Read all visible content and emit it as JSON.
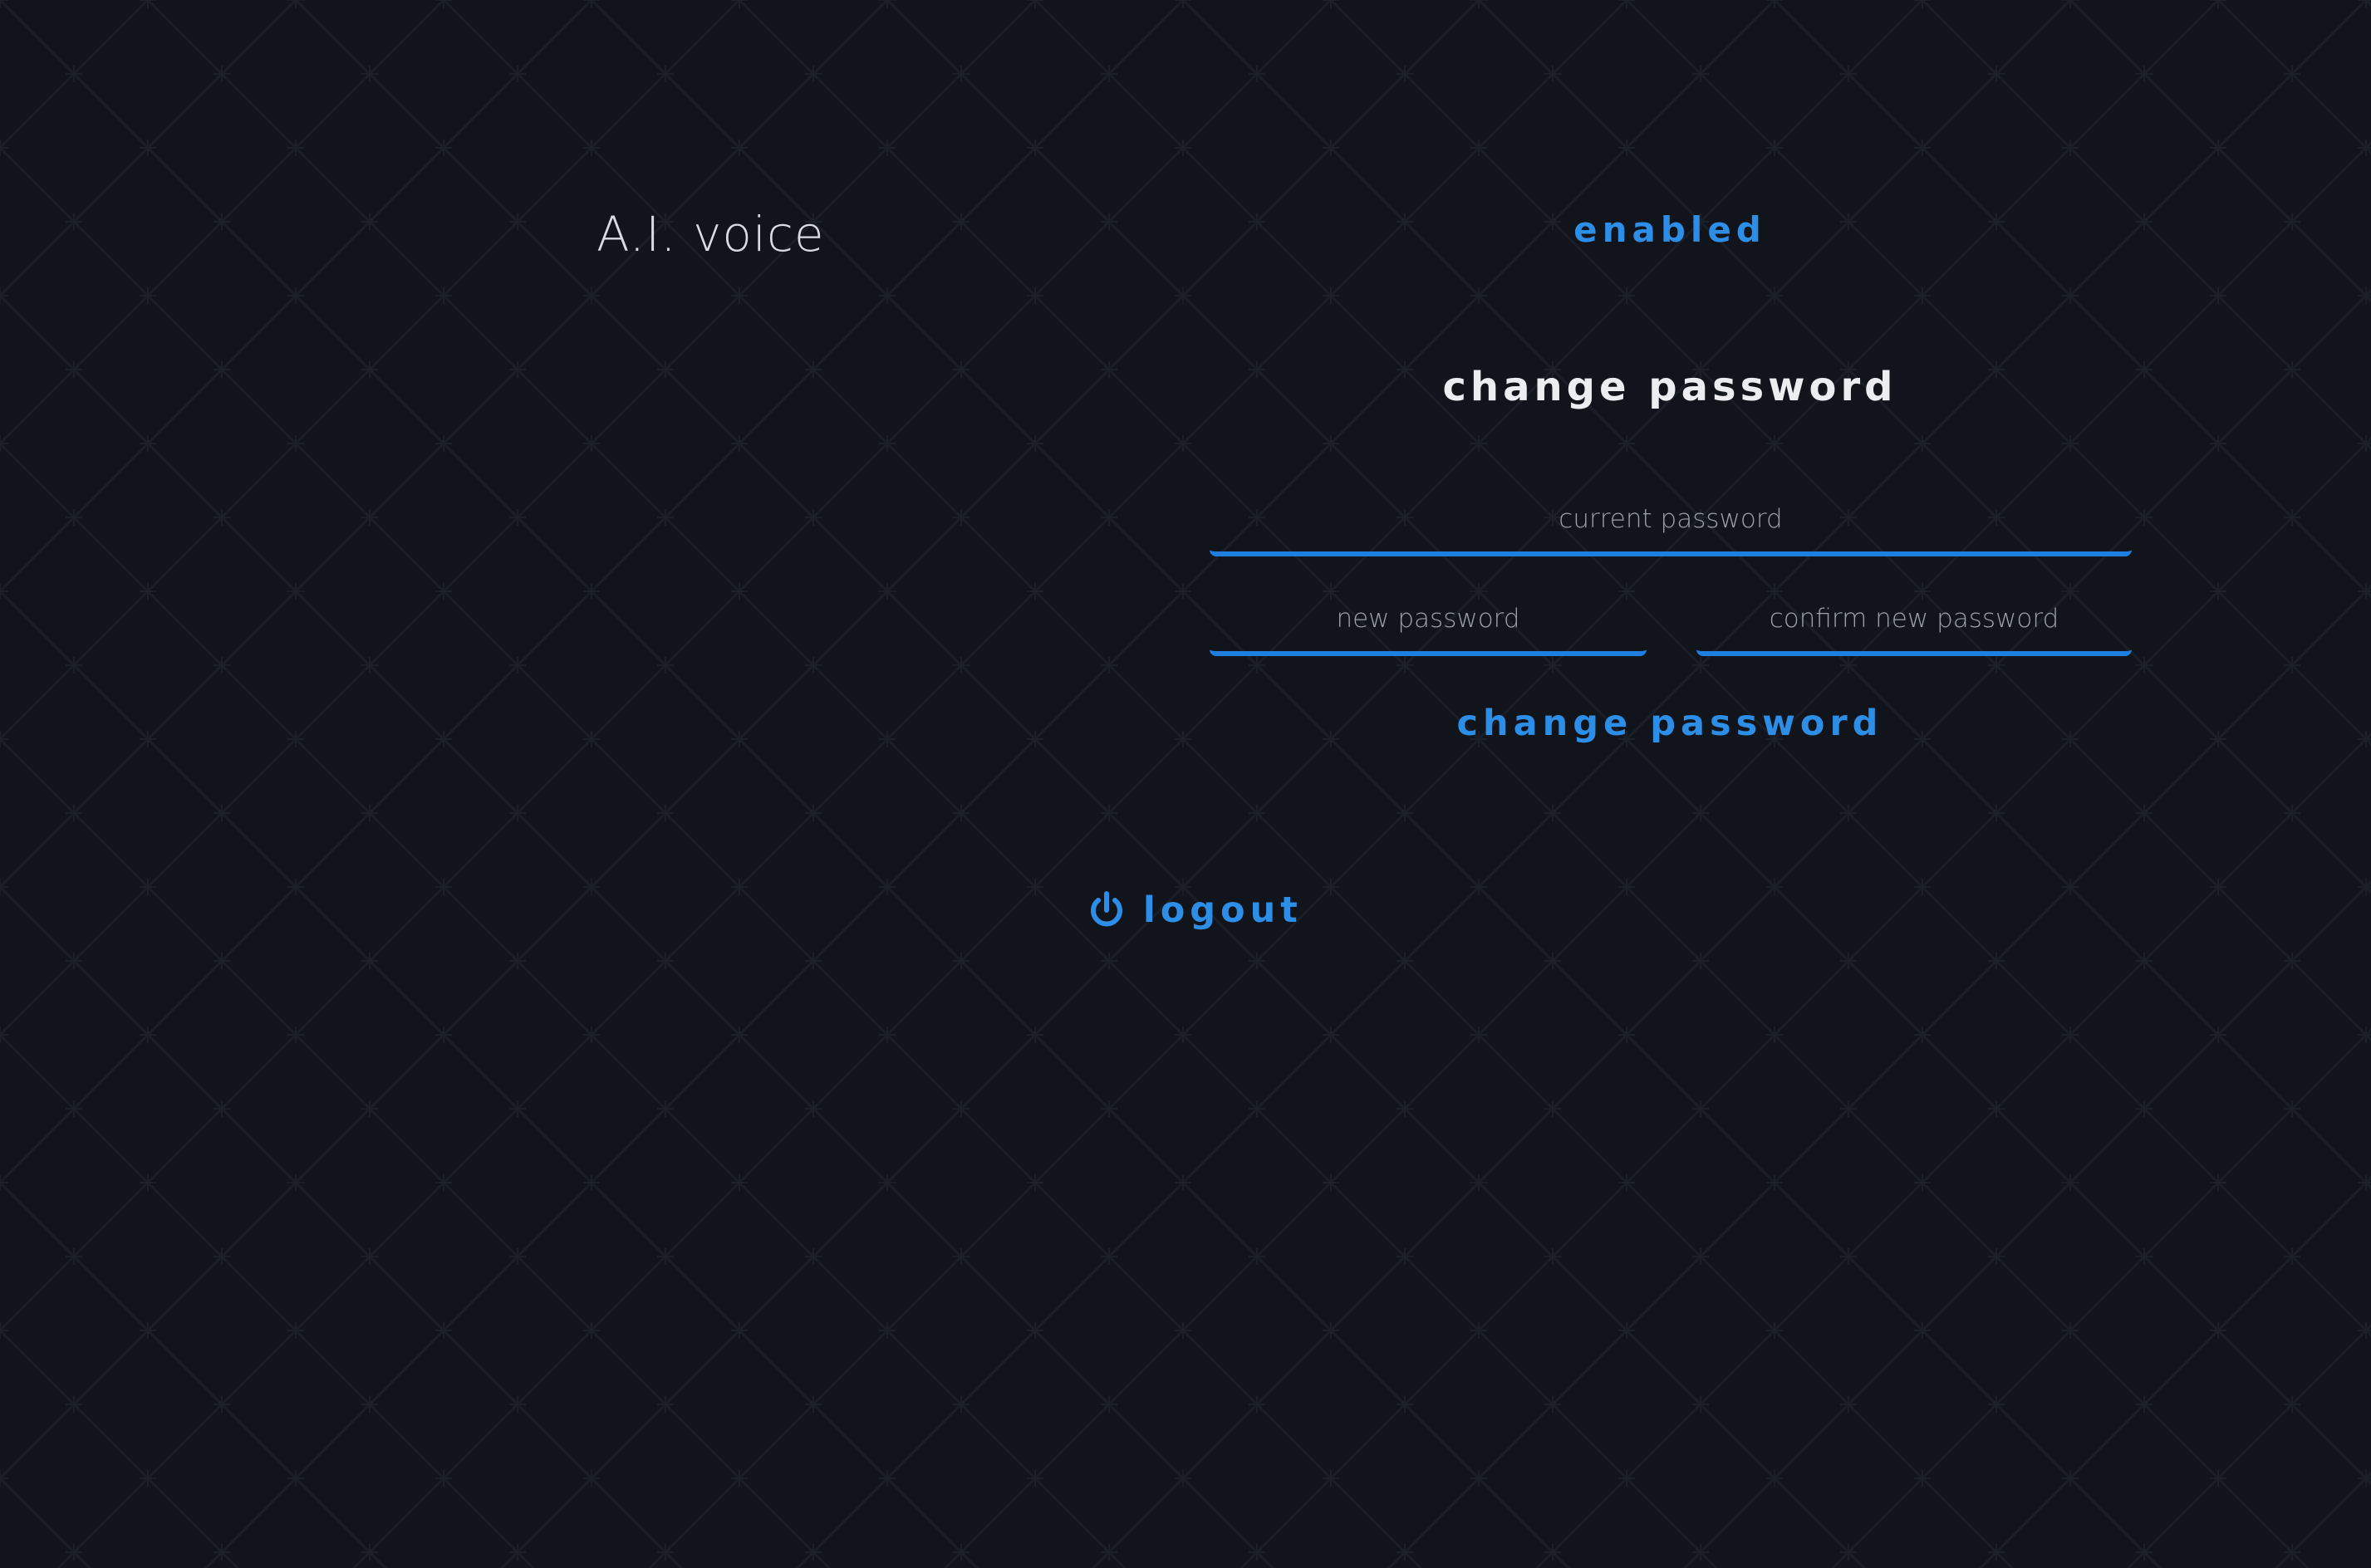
{
  "colors": {
    "background": "#11141a",
    "accent": "#2d8ee8",
    "text": "#d9dce2",
    "heading": "#ebedf0",
    "placeholder": "#9aa0aa"
  },
  "settings": {
    "ai_voice_label": "A.I. voice",
    "ai_voice_status": "enabled"
  },
  "change_password": {
    "title": "change password",
    "current_placeholder": "current password",
    "new_placeholder": "new password",
    "confirm_placeholder": "confirm new password",
    "submit_label": "change password"
  },
  "logout": {
    "label": "logout",
    "icon": "power-icon"
  }
}
